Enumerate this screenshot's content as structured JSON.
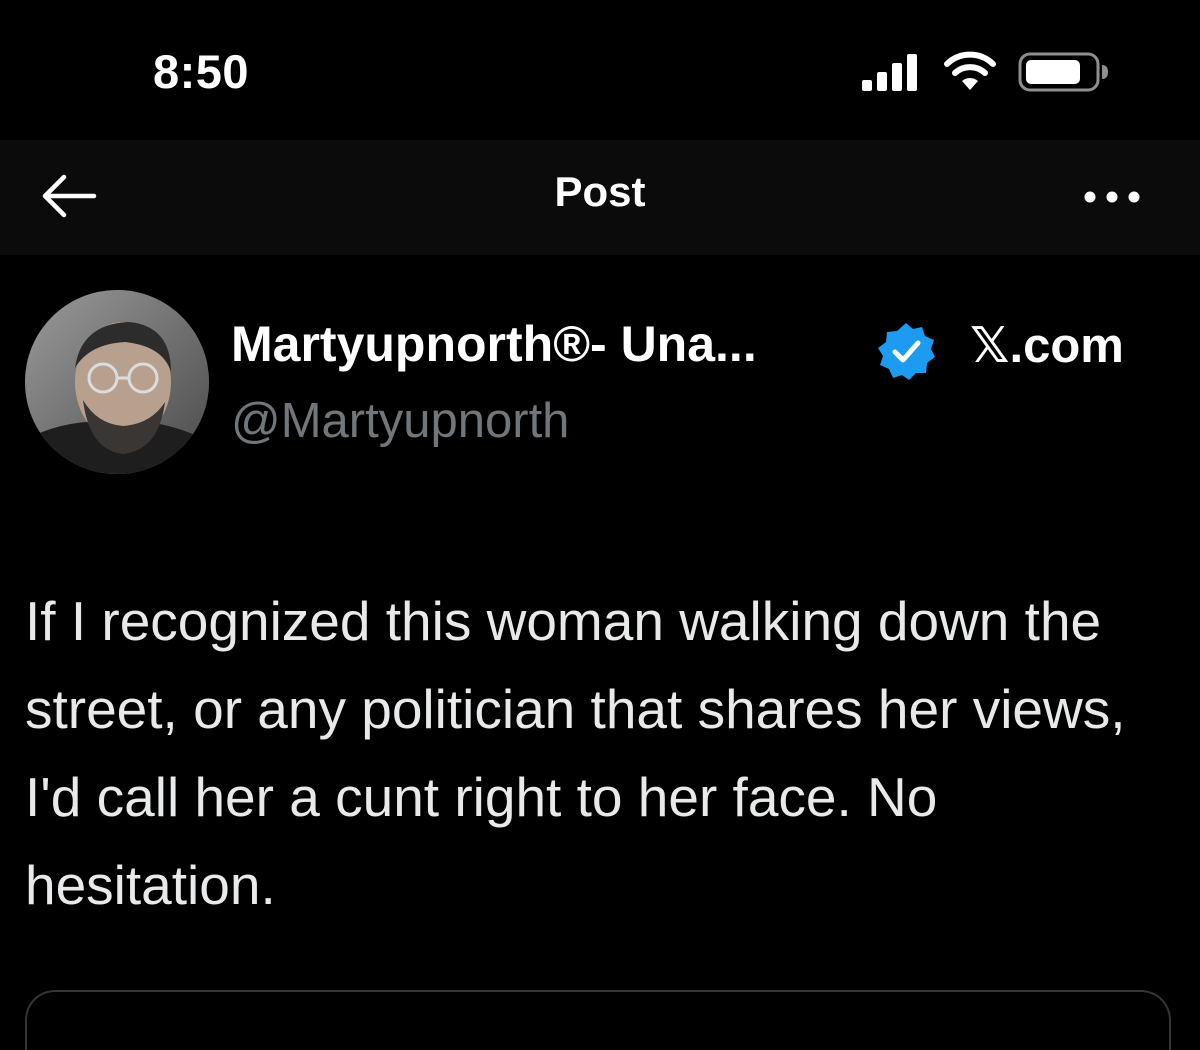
{
  "status_bar": {
    "time": "8:50",
    "icons": [
      "cellular-signal-icon",
      "wifi-icon",
      "battery-icon"
    ]
  },
  "nav": {
    "back_icon": "arrow-left-icon",
    "title": "Post",
    "more_icon": "ellipsis-icon"
  },
  "post": {
    "author_name": "Martyupnorth®- Una...",
    "verified": true,
    "domain": "𝕏.com",
    "handle": "@Martyupnorth",
    "text": "If I recognized this woman walking down the street, or any politician that shares her views, I'd call her a cunt right to her face. No hesitation."
  },
  "colors": {
    "background": "#000000",
    "nav_background": "#0b0b0b",
    "primary_text": "#e7e9ea",
    "secondary_text": "#71767b",
    "verified_blue": "#1d9bf0",
    "border": "#333639"
  }
}
